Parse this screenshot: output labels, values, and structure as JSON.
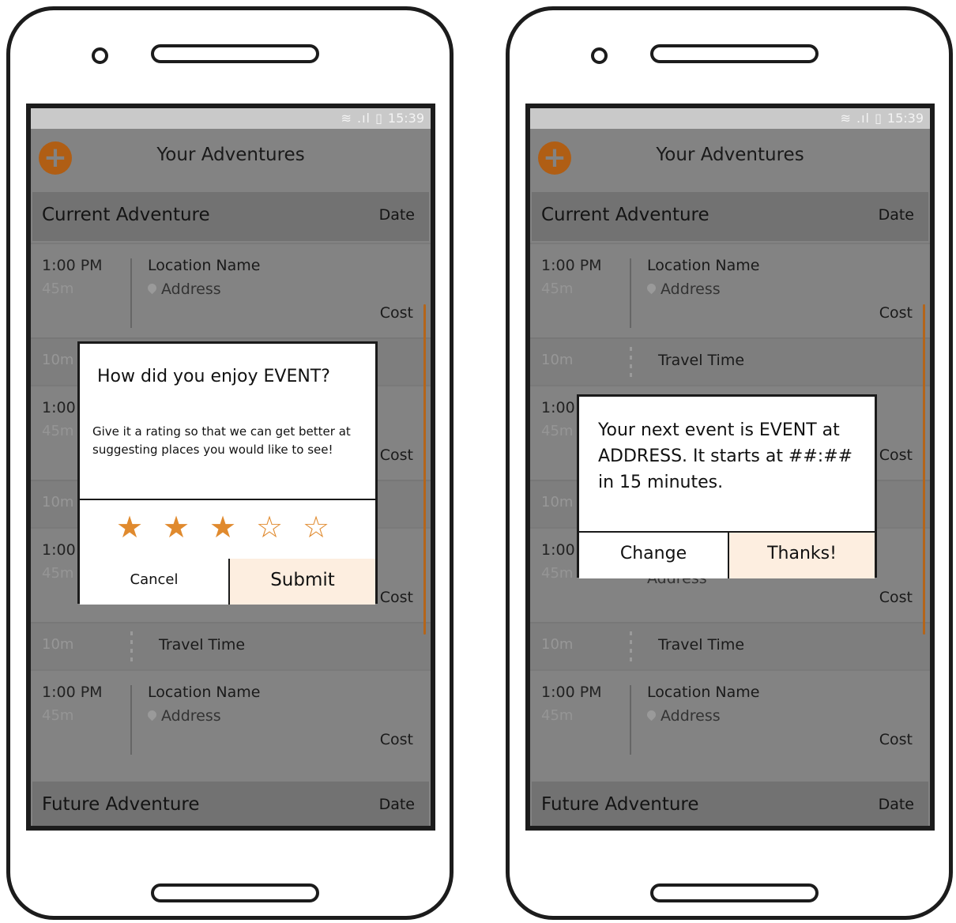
{
  "status_time": "15:39",
  "status_symbols": "≋ .ıl ▯",
  "add_icon_glyph": "+",
  "app_title": "Your Adventures",
  "current_section": {
    "title": "Current Adventure",
    "date": "Date"
  },
  "future_section": {
    "title": "Future Adventure",
    "date": "Date"
  },
  "event": {
    "time": "1:00 PM",
    "duration": "45m",
    "location": "Location Name",
    "address": "Address",
    "cost": "Cost"
  },
  "travel": {
    "duration": "10m",
    "label": "Travel Time"
  },
  "partial": {
    "time": "1:00",
    "duration": "45m",
    "duration_travel": "10m",
    "cost": "Cost",
    "address_fragment": "Address"
  },
  "rating_dialog": {
    "title": "How did you enjoy EVENT?",
    "body": "Give it a rating so that we can get better at suggesting places you would like to see!",
    "rating": 3,
    "max_rating": 5,
    "cancel_label": "Cancel",
    "submit_label": "Submit"
  },
  "next_event_dialog": {
    "message": "Your next event is EVENT at ADDRESS. It starts at ##:## in 15 minutes.",
    "change_label": "Change",
    "thanks_label": "Thanks!"
  },
  "colors": {
    "accent": "#b05e14",
    "star": "#e08a2e",
    "highlight_button": "#fdeee0",
    "overlay": "#838383"
  }
}
